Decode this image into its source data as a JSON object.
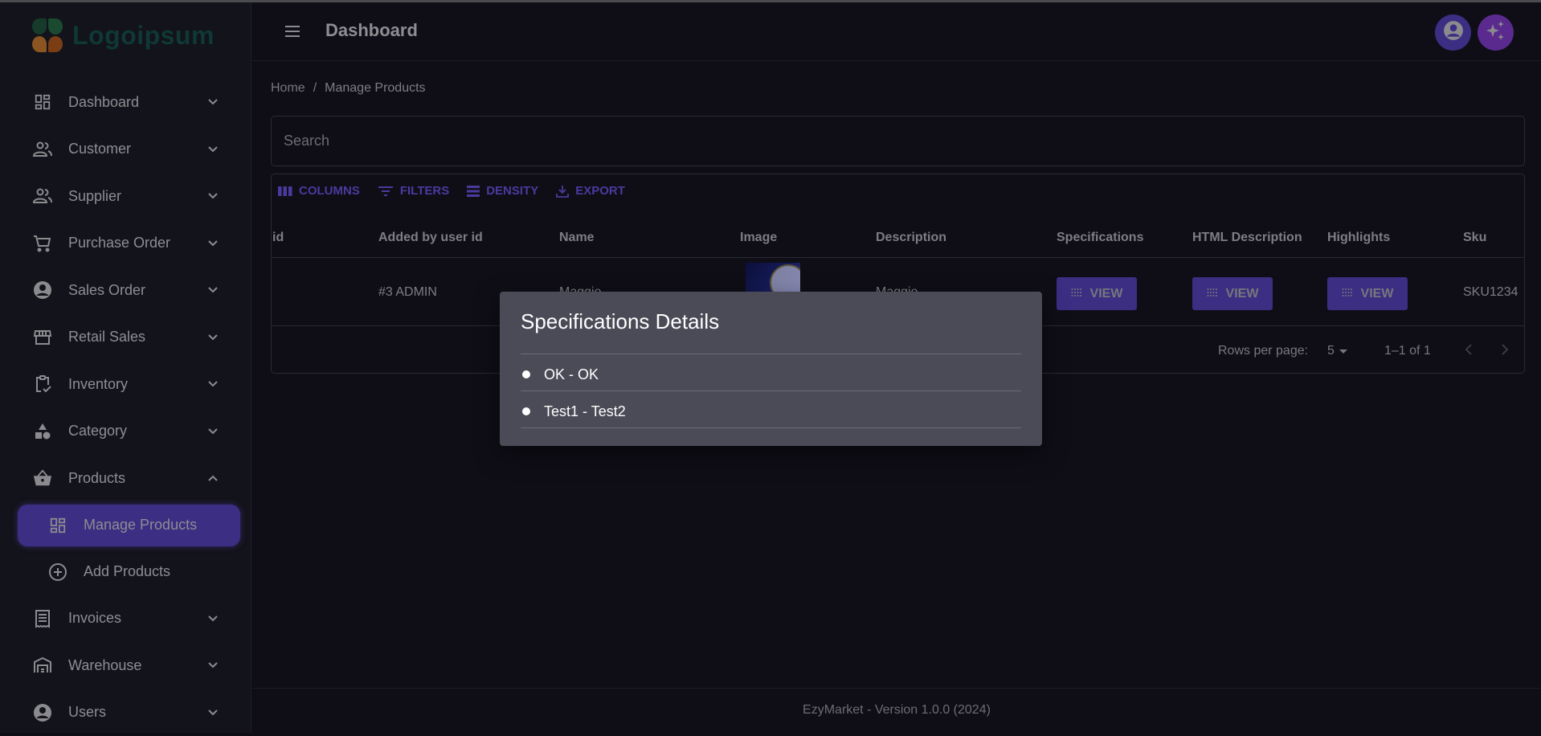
{
  "app": {
    "logo_text": "Logoipsum",
    "colors": {
      "accent": "#3b2e83",
      "accent_text": "#4b3a9e",
      "magic_button": "#5a2a8e",
      "dialog_bg": "#4a4b56",
      "background": "#0f0e17"
    }
  },
  "sidebar": {
    "items": [
      {
        "label": "Dashboard",
        "icon": "dashboard-icon",
        "expanded": false
      },
      {
        "label": "Customer",
        "icon": "people-icon",
        "expanded": false
      },
      {
        "label": "Supplier",
        "icon": "people-icon",
        "expanded": false
      },
      {
        "label": "Purchase Order",
        "icon": "cart-icon",
        "expanded": false
      },
      {
        "label": "Sales Order",
        "icon": "account-circle-icon",
        "expanded": false
      },
      {
        "label": "Retail Sales",
        "icon": "store-icon",
        "expanded": false
      },
      {
        "label": "Inventory",
        "icon": "clipboard-check-icon",
        "expanded": false
      },
      {
        "label": "Category",
        "icon": "shapes-icon",
        "expanded": false
      },
      {
        "label": "Products",
        "icon": "basket-icon",
        "expanded": true
      },
      {
        "label": "Invoices",
        "icon": "receipt-icon",
        "expanded": false
      },
      {
        "label": "Warehouse",
        "icon": "warehouse-icon",
        "expanded": false
      },
      {
        "label": "Users",
        "icon": "account-circle-icon",
        "expanded": false
      }
    ],
    "products_sub": [
      {
        "label": "Manage Products",
        "icon": "dashboard-icon",
        "active": true
      },
      {
        "label": "Add Products",
        "icon": "add-circle-icon",
        "active": false
      }
    ]
  },
  "header": {
    "title": "Dashboard"
  },
  "breadcrumb": {
    "home": "Home",
    "separator": "/",
    "current": "Manage Products"
  },
  "search": {
    "placeholder": "Search",
    "value": ""
  },
  "toolbar": {
    "columns": "COLUMNS",
    "filters": "FILTERS",
    "density": "DENSITY",
    "export": "EXPORT"
  },
  "table": {
    "columns": [
      "id",
      "Added by user id",
      "Name",
      "Image",
      "Description",
      "Specifications",
      "HTML Description",
      "Highlights",
      "Sku"
    ],
    "rows": [
      {
        "id": "",
        "added_by": "#3 ADMIN",
        "name": "Maggie",
        "image": "product-thumbnail",
        "description": "Maggie",
        "specifications": "VIEW",
        "html_description": "VIEW",
        "highlights": "VIEW",
        "sku": "SKU1234"
      }
    ]
  },
  "pagination": {
    "rows_per_page_label": "Rows per page:",
    "rows_per_page": "5",
    "range": "1–1 of 1"
  },
  "footer": {
    "text": "EzyMarket - Version 1.0.0 (2024)"
  },
  "dialog": {
    "title": "Specifications Details",
    "items": [
      "OK - OK",
      "Test1 - Test2"
    ]
  }
}
